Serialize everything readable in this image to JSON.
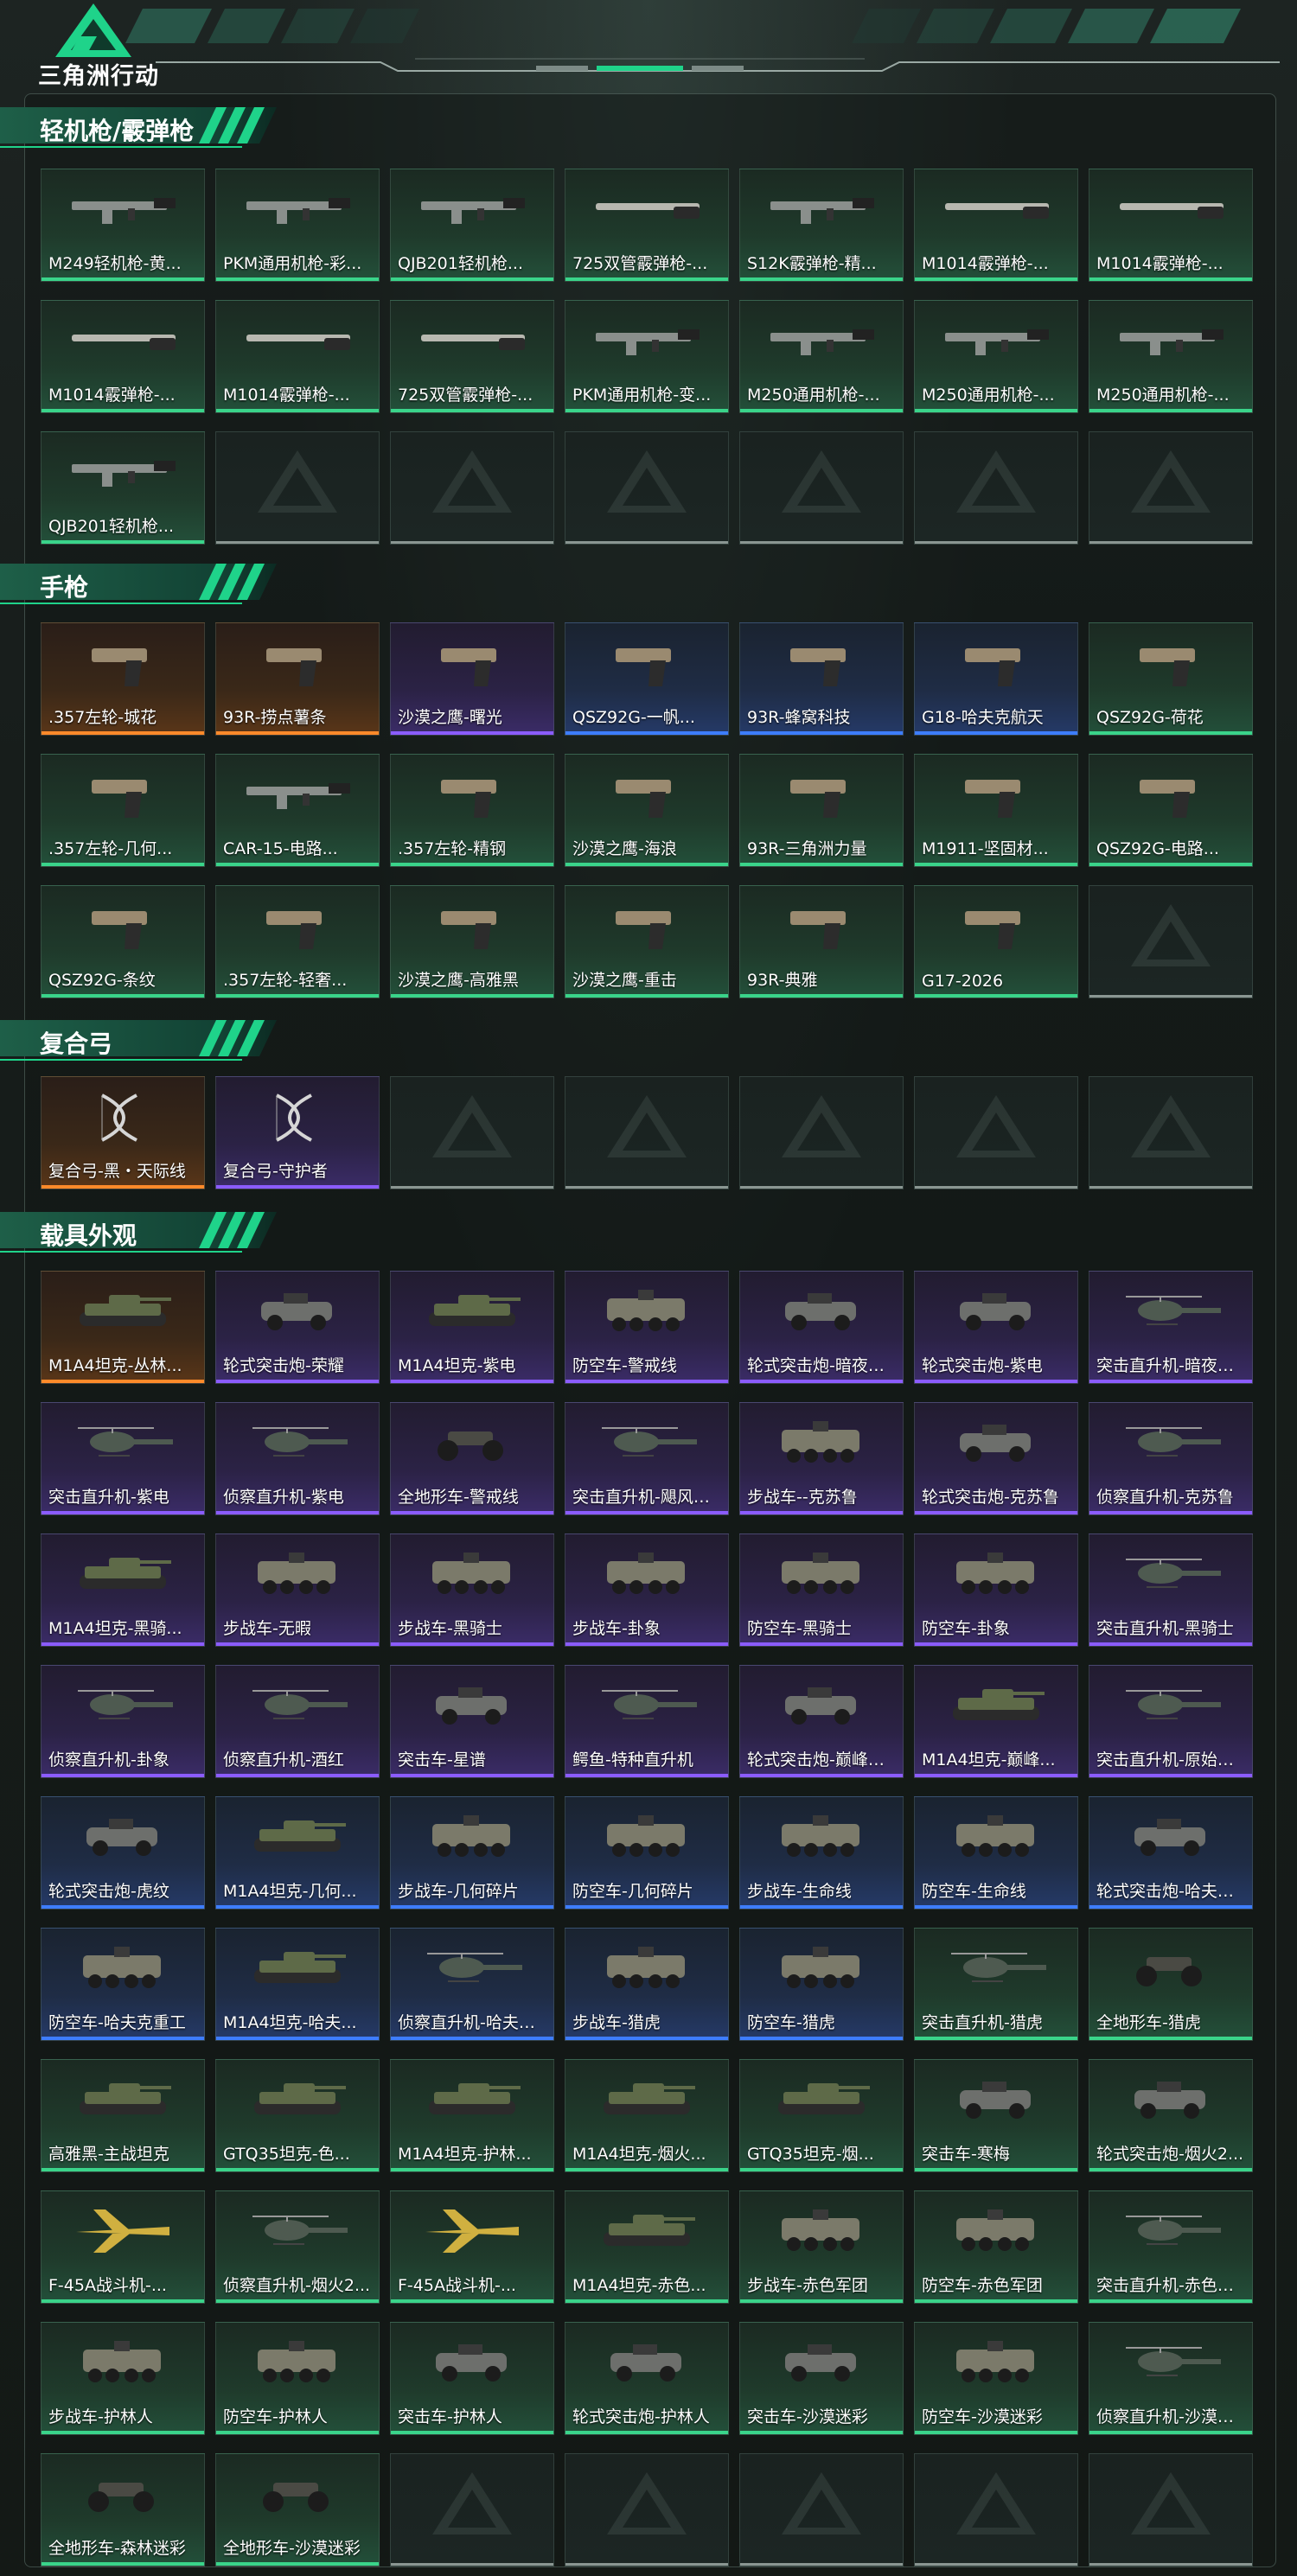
{
  "app": {
    "brand": "三角洲行动",
    "logo_icon": "delta-logo-icon"
  },
  "colors": {
    "green": "#3ad48a",
    "blue": "#3d7dff",
    "purple": "#8b5cff",
    "orange": "#ff8a2a",
    "accent": "#1fd38a"
  },
  "sections": [
    {
      "title": "轻机枪/霰弹枪",
      "items": [
        {
          "name": "M249轻机枪-黄...",
          "rarity": "green",
          "kind": "gun"
        },
        {
          "name": "PKM通用机枪-彩...",
          "rarity": "green",
          "kind": "gun"
        },
        {
          "name": "QJB201轻机枪...",
          "rarity": "green",
          "kind": "gun"
        },
        {
          "name": "725双管霰弹枪-...",
          "rarity": "green",
          "kind": "shotgun"
        },
        {
          "name": "S12K霰弹枪-精...",
          "rarity": "green",
          "kind": "gun"
        },
        {
          "name": "M1014霰弹枪-...",
          "rarity": "green",
          "kind": "shotgun"
        },
        {
          "name": "M1014霰弹枪-...",
          "rarity": "green",
          "kind": "shotgun"
        },
        {
          "name": "M1014霰弹枪-...",
          "rarity": "green",
          "kind": "shotgun"
        },
        {
          "name": "M1014霰弹枪-...",
          "rarity": "green",
          "kind": "shotgun"
        },
        {
          "name": "725双管霰弹枪-...",
          "rarity": "green",
          "kind": "shotgun"
        },
        {
          "name": "PKM通用机枪-变...",
          "rarity": "green",
          "kind": "gun"
        },
        {
          "name": "M250通用机枪-...",
          "rarity": "green",
          "kind": "gun"
        },
        {
          "name": "M250通用机枪-...",
          "rarity": "green",
          "kind": "gun"
        },
        {
          "name": "M250通用机枪-...",
          "rarity": "green",
          "kind": "gun"
        },
        {
          "name": "QJB201轻机枪...",
          "rarity": "green",
          "kind": "gun"
        }
      ]
    },
    {
      "title": "手枪",
      "items": [
        {
          "name": ".357左轮-城花",
          "rarity": "orange",
          "kind": "pistol"
        },
        {
          "name": "93R-捞点薯条",
          "rarity": "orange",
          "kind": "pistol"
        },
        {
          "name": "沙漠之鹰-曙光",
          "rarity": "purple",
          "kind": "pistol"
        },
        {
          "name": "QSZ92G-一帆...",
          "rarity": "blue",
          "kind": "pistol"
        },
        {
          "name": "93R-蜂窝科技",
          "rarity": "blue",
          "kind": "pistol"
        },
        {
          "name": "G18-哈夫克航天",
          "rarity": "blue",
          "kind": "pistol"
        },
        {
          "name": "QSZ92G-荷花",
          "rarity": "green",
          "kind": "pistol"
        },
        {
          "name": ".357左轮-几何...",
          "rarity": "green",
          "kind": "pistol"
        },
        {
          "name": "CAR-15-电路...",
          "rarity": "green",
          "kind": "gun"
        },
        {
          "name": ".357左轮-精钢",
          "rarity": "green",
          "kind": "pistol"
        },
        {
          "name": "沙漠之鹰-海浪",
          "rarity": "green",
          "kind": "pistol"
        },
        {
          "name": "93R-三角洲力量",
          "rarity": "green",
          "kind": "pistol"
        },
        {
          "name": "M1911-坚固材...",
          "rarity": "green",
          "kind": "pistol"
        },
        {
          "name": "QSZ92G-电路...",
          "rarity": "green",
          "kind": "pistol"
        },
        {
          "name": "QSZ92G-条纹",
          "rarity": "green",
          "kind": "pistol"
        },
        {
          "name": ".357左轮-轻奢...",
          "rarity": "green",
          "kind": "pistol"
        },
        {
          "name": "沙漠之鹰-高雅黑",
          "rarity": "green",
          "kind": "pistol"
        },
        {
          "name": "沙漠之鹰-重击",
          "rarity": "green",
          "kind": "pistol"
        },
        {
          "name": "93R-典雅",
          "rarity": "green",
          "kind": "pistol"
        },
        {
          "name": "G17-2026",
          "rarity": "green",
          "kind": "pistol"
        }
      ]
    },
    {
      "title": "复合弓",
      "items": [
        {
          "name": "复合弓-黑・天际线",
          "rarity": "orange",
          "kind": "bow"
        },
        {
          "name": "复合弓-守护者",
          "rarity": "purple",
          "kind": "bow"
        }
      ]
    },
    {
      "title": "载具外观",
      "items": [
        {
          "name": "M1A4坦克-丛林...",
          "rarity": "orange",
          "kind": "tank"
        },
        {
          "name": "轮式突击炮-荣耀",
          "rarity": "purple",
          "kind": "car"
        },
        {
          "name": "M1A4坦克-紫电",
          "rarity": "purple",
          "kind": "tank"
        },
        {
          "name": "防空车-警戒线",
          "rarity": "purple",
          "kind": "apc"
        },
        {
          "name": "轮式突击炮-暗夜行...",
          "rarity": "purple",
          "kind": "car"
        },
        {
          "name": "轮式突击炮-紫电",
          "rarity": "purple",
          "kind": "car"
        },
        {
          "name": "突击直升机-暗夜行...",
          "rarity": "purple",
          "kind": "heli"
        },
        {
          "name": "突击直升机-紫电",
          "rarity": "purple",
          "kind": "heli"
        },
        {
          "name": "侦察直升机-紫电",
          "rarity": "purple",
          "kind": "heli"
        },
        {
          "name": "全地形车-警戒线",
          "rarity": "purple",
          "kind": "atv"
        },
        {
          "name": "突击直升机-飓风行...",
          "rarity": "purple",
          "kind": "heli"
        },
        {
          "name": "步战车--克苏鲁",
          "rarity": "purple",
          "kind": "apc"
        },
        {
          "name": "轮式突击炮-克苏鲁",
          "rarity": "purple",
          "kind": "car"
        },
        {
          "name": "侦察直升机-克苏鲁",
          "rarity": "purple",
          "kind": "heli"
        },
        {
          "name": "M1A4坦克-黑骑...",
          "rarity": "purple",
          "kind": "tank"
        },
        {
          "name": "步战车-无暇",
          "rarity": "purple",
          "kind": "apc"
        },
        {
          "name": "步战车-黑骑士",
          "rarity": "purple",
          "kind": "apc"
        },
        {
          "name": "步战车-卦象",
          "rarity": "purple",
          "kind": "apc"
        },
        {
          "name": "防空车-黑骑士",
          "rarity": "purple",
          "kind": "apc"
        },
        {
          "name": "防空车-卦象",
          "rarity": "purple",
          "kind": "apc"
        },
        {
          "name": "突击直升机-黑骑士",
          "rarity": "purple",
          "kind": "heli"
        },
        {
          "name": "侦察直升机-卦象",
          "rarity": "purple",
          "kind": "heli"
        },
        {
          "name": "侦察直升机-酒红",
          "rarity": "purple",
          "kind": "heli"
        },
        {
          "name": "突击车-星谱",
          "rarity": "purple",
          "kind": "car"
        },
        {
          "name": "鳄鱼-特种直升机",
          "rarity": "purple",
          "kind": "heli"
        },
        {
          "name": "轮式突击炮-巅峰竞...",
          "rarity": "purple",
          "kind": "car"
        },
        {
          "name": "M1A4坦克-巅峰...",
          "rarity": "purple",
          "kind": "tank"
        },
        {
          "name": "突击直升机-原始伪...",
          "rarity": "purple",
          "kind": "heli"
        },
        {
          "name": "轮式突击炮-虎纹",
          "rarity": "blue",
          "kind": "car"
        },
        {
          "name": "M1A4坦克-几何...",
          "rarity": "blue",
          "kind": "tank"
        },
        {
          "name": "步战车-几何碎片",
          "rarity": "blue",
          "kind": "apc"
        },
        {
          "name": "防空车-几何碎片",
          "rarity": "blue",
          "kind": "apc"
        },
        {
          "name": "步战车-生命线",
          "rarity": "blue",
          "kind": "apc"
        },
        {
          "name": "防空车-生命线",
          "rarity": "blue",
          "kind": "apc"
        },
        {
          "name": "轮式突击炮-哈夫克...",
          "rarity": "blue",
          "kind": "car"
        },
        {
          "name": "防空车-哈夫克重工",
          "rarity": "blue",
          "kind": "apc"
        },
        {
          "name": "M1A4坦克-哈夫...",
          "rarity": "blue",
          "kind": "tank"
        },
        {
          "name": "侦察直升机-哈夫克...",
          "rarity": "blue",
          "kind": "heli"
        },
        {
          "name": "步战车-猎虎",
          "rarity": "blue",
          "kind": "apc"
        },
        {
          "name": "防空车-猎虎",
          "rarity": "blue",
          "kind": "apc"
        },
        {
          "name": "突击直升机-猎虎",
          "rarity": "green",
          "kind": "heli"
        },
        {
          "name": "全地形车-猎虎",
          "rarity": "green",
          "kind": "atv"
        },
        {
          "name": "高雅黑-主战坦克",
          "rarity": "green",
          "kind": "tank"
        },
        {
          "name": "GTQ35坦克-色...",
          "rarity": "green",
          "kind": "tank"
        },
        {
          "name": "M1A4坦克-护林...",
          "rarity": "green",
          "kind": "tank"
        },
        {
          "name": "M1A4坦克-烟火...",
          "rarity": "green",
          "kind": "tank"
        },
        {
          "name": "GTQ35坦克-烟...",
          "rarity": "green",
          "kind": "tank"
        },
        {
          "name": "突击车-寒梅",
          "rarity": "green",
          "kind": "car"
        },
        {
          "name": "轮式突击炮-烟火2...",
          "rarity": "green",
          "kind": "car"
        },
        {
          "name": "F-45A战斗机-...",
          "rarity": "green",
          "kind": "jet"
        },
        {
          "name": "侦察直升机-烟火2...",
          "rarity": "green",
          "kind": "heli"
        },
        {
          "name": "F-45A战斗机-...",
          "rarity": "green",
          "kind": "jet"
        },
        {
          "name": "M1A4坦克-赤色...",
          "rarity": "green",
          "kind": "tank"
        },
        {
          "name": "步战车-赤色军团",
          "rarity": "green",
          "kind": "apc"
        },
        {
          "name": "防空车-赤色军团",
          "rarity": "green",
          "kind": "apc"
        },
        {
          "name": "突击直升机-赤色军...",
          "rarity": "green",
          "kind": "heli"
        },
        {
          "name": "步战车-护林人",
          "rarity": "green",
          "kind": "apc"
        },
        {
          "name": "防空车-护林人",
          "rarity": "green",
          "kind": "apc"
        },
        {
          "name": "突击车-护林人",
          "rarity": "green",
          "kind": "car"
        },
        {
          "name": "轮式突击炮-护林人",
          "rarity": "green",
          "kind": "car"
        },
        {
          "name": "突击车-沙漠迷彩",
          "rarity": "green",
          "kind": "car"
        },
        {
          "name": "防空车-沙漠迷彩",
          "rarity": "green",
          "kind": "apc"
        },
        {
          "name": "侦察直升机-沙漠迷...",
          "rarity": "green",
          "kind": "heli"
        },
        {
          "name": "全地形车-森林迷彩",
          "rarity": "green",
          "kind": "atv"
        },
        {
          "name": "全地形车-沙漠迷彩",
          "rarity": "green",
          "kind": "atv"
        }
      ]
    }
  ]
}
